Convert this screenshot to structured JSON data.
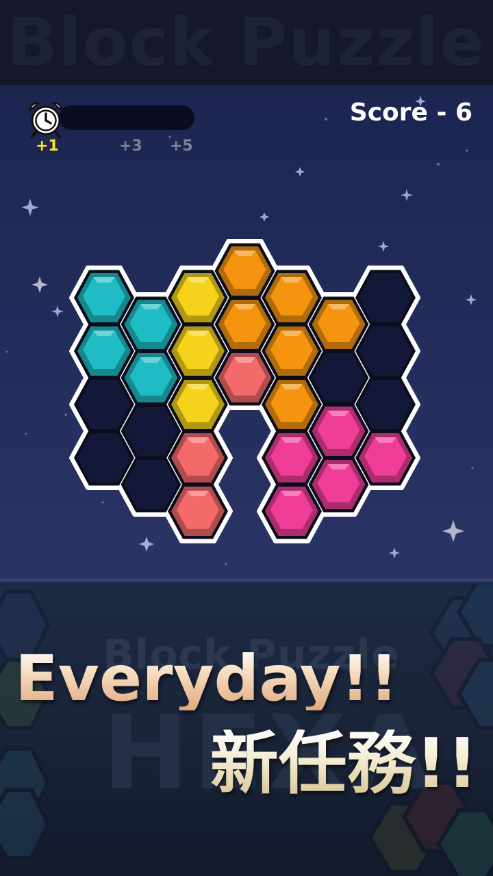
{
  "app": {
    "title": "Block Puzzle"
  },
  "hud": {
    "timer_icon": "alarm-clock-icon",
    "timer_progress": 0.0,
    "bonuses": [
      "+1",
      "+3",
      "+5"
    ],
    "active_bonus_index": 0,
    "score_text": "Score - 6"
  },
  "board": {
    "colors": {
      "cyan": "#1fbcc4",
      "yellow": "#f5d31a",
      "orange": "#f5940f",
      "salmon": "#f46a6a",
      "pink": "#ef3d98",
      "empty": "#141838"
    },
    "cells": [
      {
        "col": 0,
        "row": 0,
        "color": "cyan"
      },
      {
        "col": 0,
        "row": 1,
        "color": "cyan"
      },
      {
        "col": 0,
        "row": 2,
        "color": "empty"
      },
      {
        "col": 0,
        "row": 3,
        "color": "empty"
      },
      {
        "col": 1,
        "row": 0,
        "color": "cyan"
      },
      {
        "col": 1,
        "row": 1,
        "color": "cyan"
      },
      {
        "col": 1,
        "row": 2,
        "color": "empty"
      },
      {
        "col": 1,
        "row": 3,
        "color": "empty"
      },
      {
        "col": 2,
        "row": 0,
        "color": "yellow"
      },
      {
        "col": 2,
        "row": 1,
        "color": "yellow"
      },
      {
        "col": 2,
        "row": 2,
        "color": "yellow"
      },
      {
        "col": 2,
        "row": 3,
        "color": "salmon"
      },
      {
        "col": 2,
        "row": 4,
        "color": "salmon"
      },
      {
        "col": 3,
        "row": 0,
        "color": "orange"
      },
      {
        "col": 3,
        "row": 1,
        "color": "orange"
      },
      {
        "col": 3,
        "row": 2,
        "color": "salmon"
      },
      {
        "col": 4,
        "row": 0,
        "color": "orange"
      },
      {
        "col": 4,
        "row": 1,
        "color": "orange"
      },
      {
        "col": 4,
        "row": 2,
        "color": "orange"
      },
      {
        "col": 4,
        "row": 3,
        "color": "pink"
      },
      {
        "col": 4,
        "row": 4,
        "color": "pink"
      },
      {
        "col": 5,
        "row": 0,
        "color": "orange"
      },
      {
        "col": 5,
        "row": 1,
        "color": "empty"
      },
      {
        "col": 5,
        "row": 2,
        "color": "pink"
      },
      {
        "col": 5,
        "row": 3,
        "color": "pink"
      },
      {
        "col": 6,
        "row": 0,
        "color": "empty"
      },
      {
        "col": 6,
        "row": 1,
        "color": "empty"
      },
      {
        "col": 6,
        "row": 2,
        "color": "empty"
      },
      {
        "col": 6,
        "row": 3,
        "color": "pink"
      }
    ]
  },
  "promo": {
    "faded_logo_top": "Block Puzzle",
    "faded_logo_bottom": "HEXA",
    "headline_en": "Everyday!!",
    "headline_zh": "新任務!!"
  }
}
